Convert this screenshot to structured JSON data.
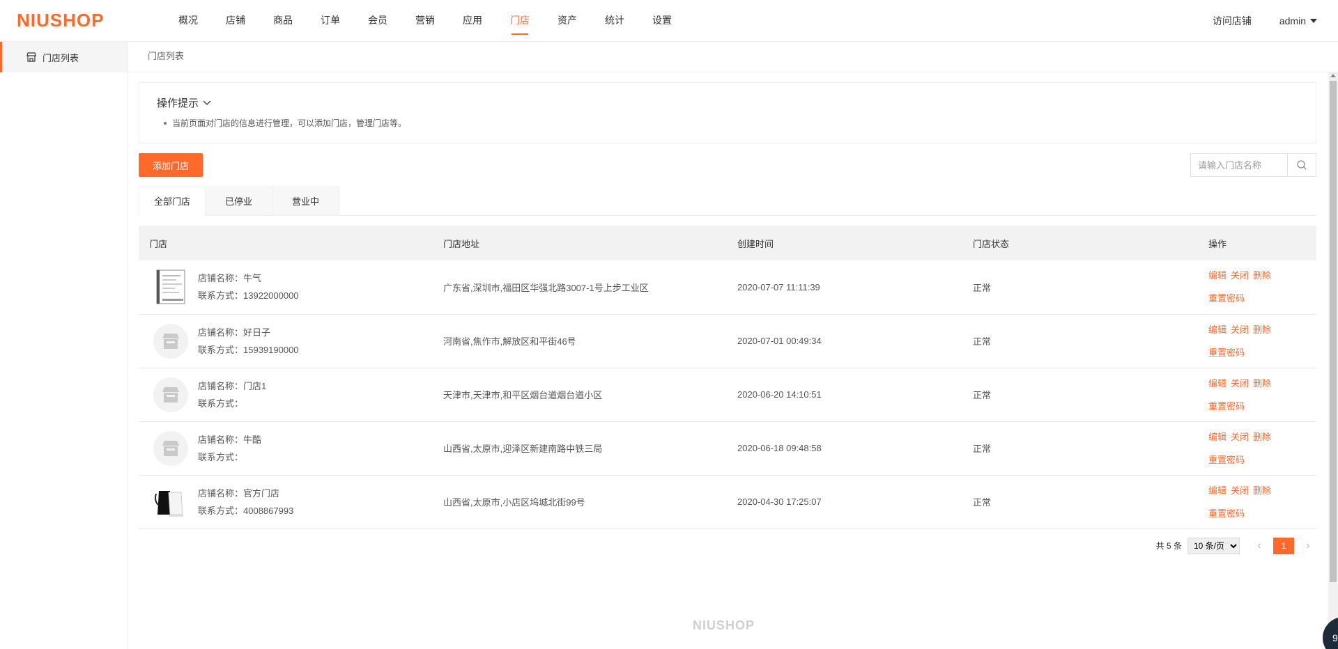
{
  "header": {
    "logo": "NIUSHOP",
    "nav": [
      "概况",
      "店铺",
      "商品",
      "订单",
      "会员",
      "营销",
      "应用",
      "门店",
      "资产",
      "统计",
      "设置"
    ],
    "active_nav": "门店",
    "visit_store": "访问店铺",
    "user": "admin"
  },
  "sidebar": {
    "items": [
      {
        "label": "门店列表"
      }
    ]
  },
  "breadcrumb": "门店列表",
  "tip": {
    "title": "操作提示",
    "text": "当前页面对门店的信息进行管理，可以添加门店，管理门店等。"
  },
  "toolbar": {
    "add_label": "添加门店",
    "search_placeholder": "请输入门店名称"
  },
  "tabs": [
    {
      "label": "全部门店",
      "active": true
    },
    {
      "label": "已停业",
      "active": false
    },
    {
      "label": "营业中",
      "active": false
    }
  ],
  "table": {
    "headers": [
      "门店",
      "门店地址",
      "创建时间",
      "门店状态",
      "操作"
    ],
    "rows": [
      {
        "name": "店铺名称：牛气",
        "contact": "联系方式：13922000000",
        "address": "广东省,深圳市,福田区华强北路3007-1号上步工业区",
        "created": "2020-07-07 11:11:39",
        "status": "正常",
        "thumb": "document-thumb"
      },
      {
        "name": "店铺名称：好日子",
        "contact": "联系方式：15939190000",
        "address": "河南省,焦作市,解放区和平街46号",
        "created": "2020-07-01 00:49:34",
        "status": "正常",
        "thumb": "store-icon"
      },
      {
        "name": "店铺名称：门店1",
        "contact": "联系方式：",
        "address": "天津市,天津市,和平区烟台道烟台道小区",
        "created": "2020-06-20 14:10:51",
        "status": "正常",
        "thumb": "store-icon"
      },
      {
        "name": "店铺名称：牛酷",
        "contact": "联系方式：",
        "address": "山西省,太原市,迎泽区新建南路中铁三局",
        "created": "2020-06-18 09:48:58",
        "status": "正常",
        "thumb": "store-icon"
      },
      {
        "name": "店铺名称：官方门店",
        "contact": "联系方式：4008867993",
        "address": "山西省,太原市,小店区坞城北街99号",
        "created": "2020-04-30 17:25:07",
        "status": "正常",
        "thumb": "kettle-thumb"
      }
    ],
    "actions": {
      "edit": "编辑",
      "close": "关闭",
      "delete": "删除",
      "reset": "重置密码"
    }
  },
  "pager": {
    "total": "共 5 条",
    "page_size": "10 条/页",
    "current": "1"
  },
  "footer_logo": "NIUSHOP",
  "float_button": "9",
  "colors": {
    "accent": "#ff6a2a"
  }
}
